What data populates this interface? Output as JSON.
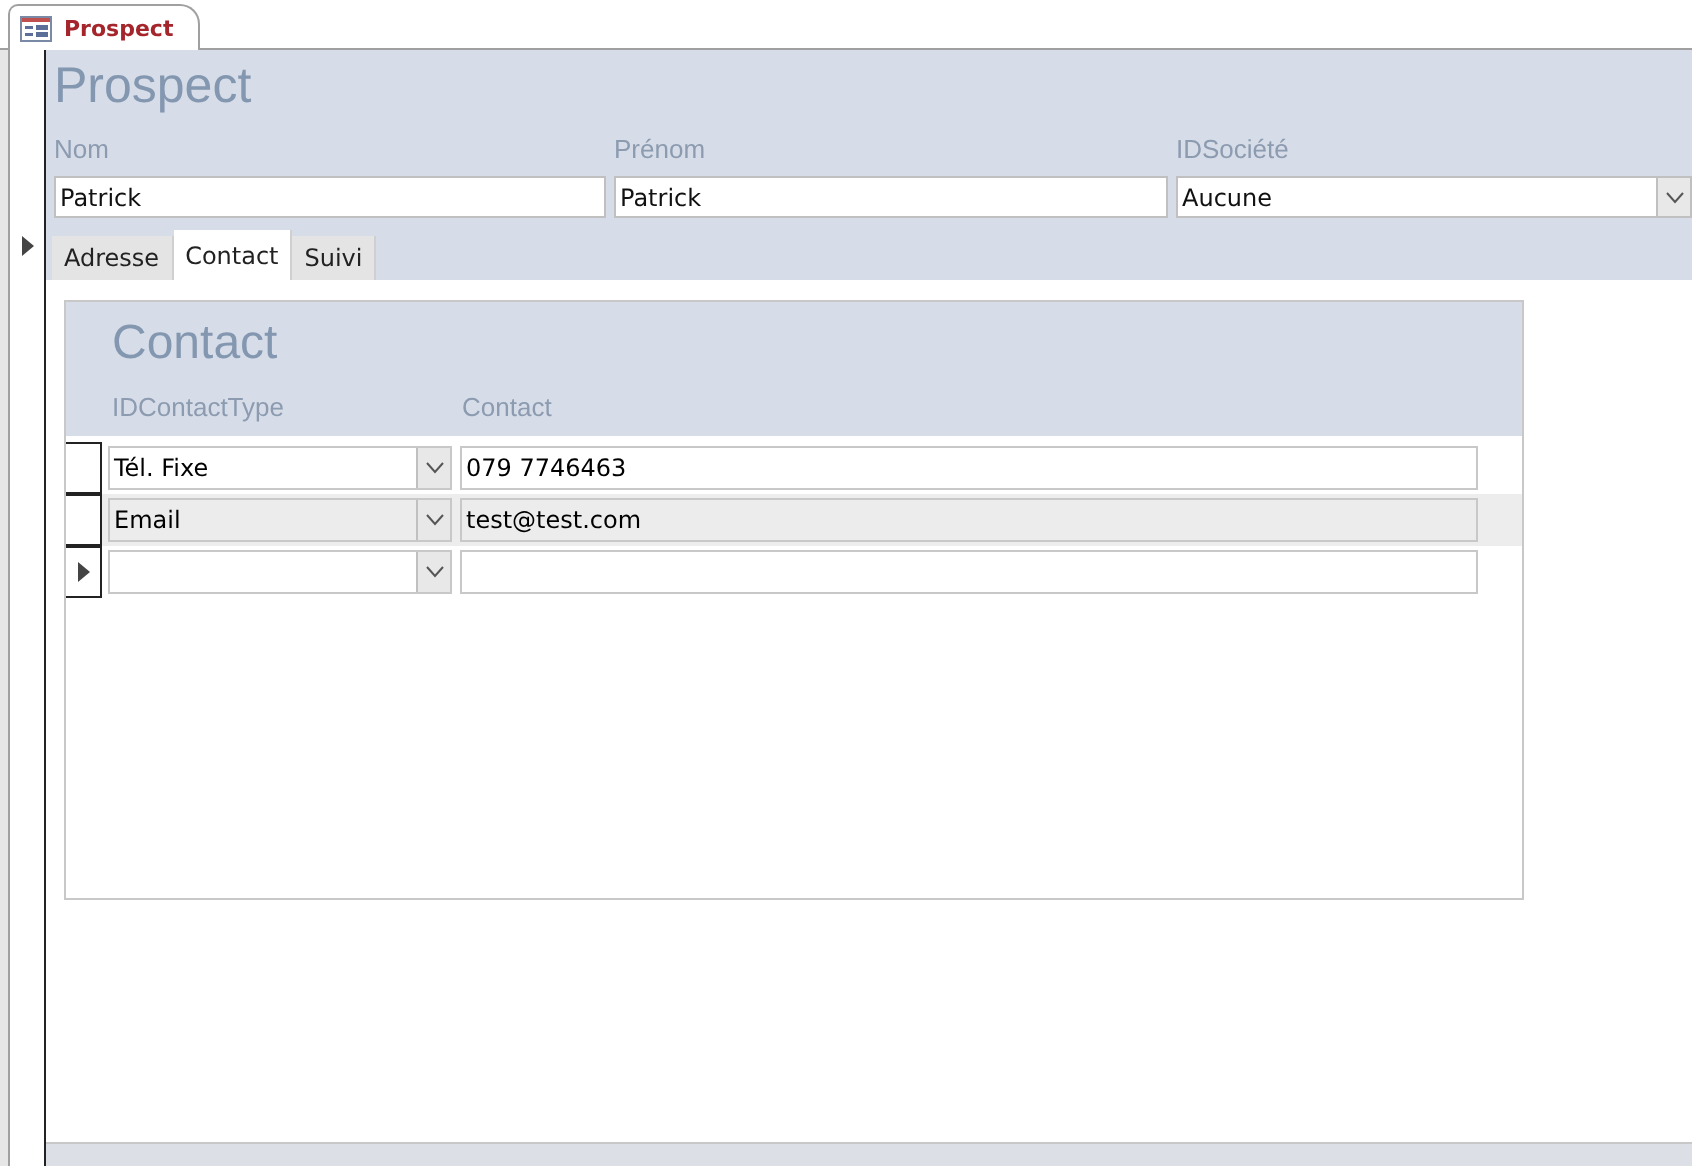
{
  "document_tab": {
    "title": "Prospect",
    "selected": true
  },
  "form": {
    "title": "Prospect",
    "record_current": true,
    "fields": [
      {
        "label": "Nom",
        "value": "Patrick",
        "kind": "text"
      },
      {
        "label": "Prénom",
        "value": "Patrick",
        "kind": "text"
      },
      {
        "label": "IDSociété",
        "value": "Aucune",
        "kind": "combo"
      }
    ],
    "tabs": [
      {
        "label": "Adresse",
        "selected": false
      },
      {
        "label": "Contact",
        "selected": true
      },
      {
        "label": "Suivi",
        "selected": false
      }
    ],
    "subform": {
      "title": "Contact",
      "columns": [
        "IDContactType",
        "Contact"
      ],
      "rows": [
        {
          "type": "Tél. Fixe",
          "contact": "079 7746463",
          "current": false,
          "shaded": false
        },
        {
          "type": "Email",
          "contact": "test@test.com",
          "current": false,
          "shaded": true
        },
        {
          "current": true,
          "shaded": false
        }
      ]
    }
  }
}
